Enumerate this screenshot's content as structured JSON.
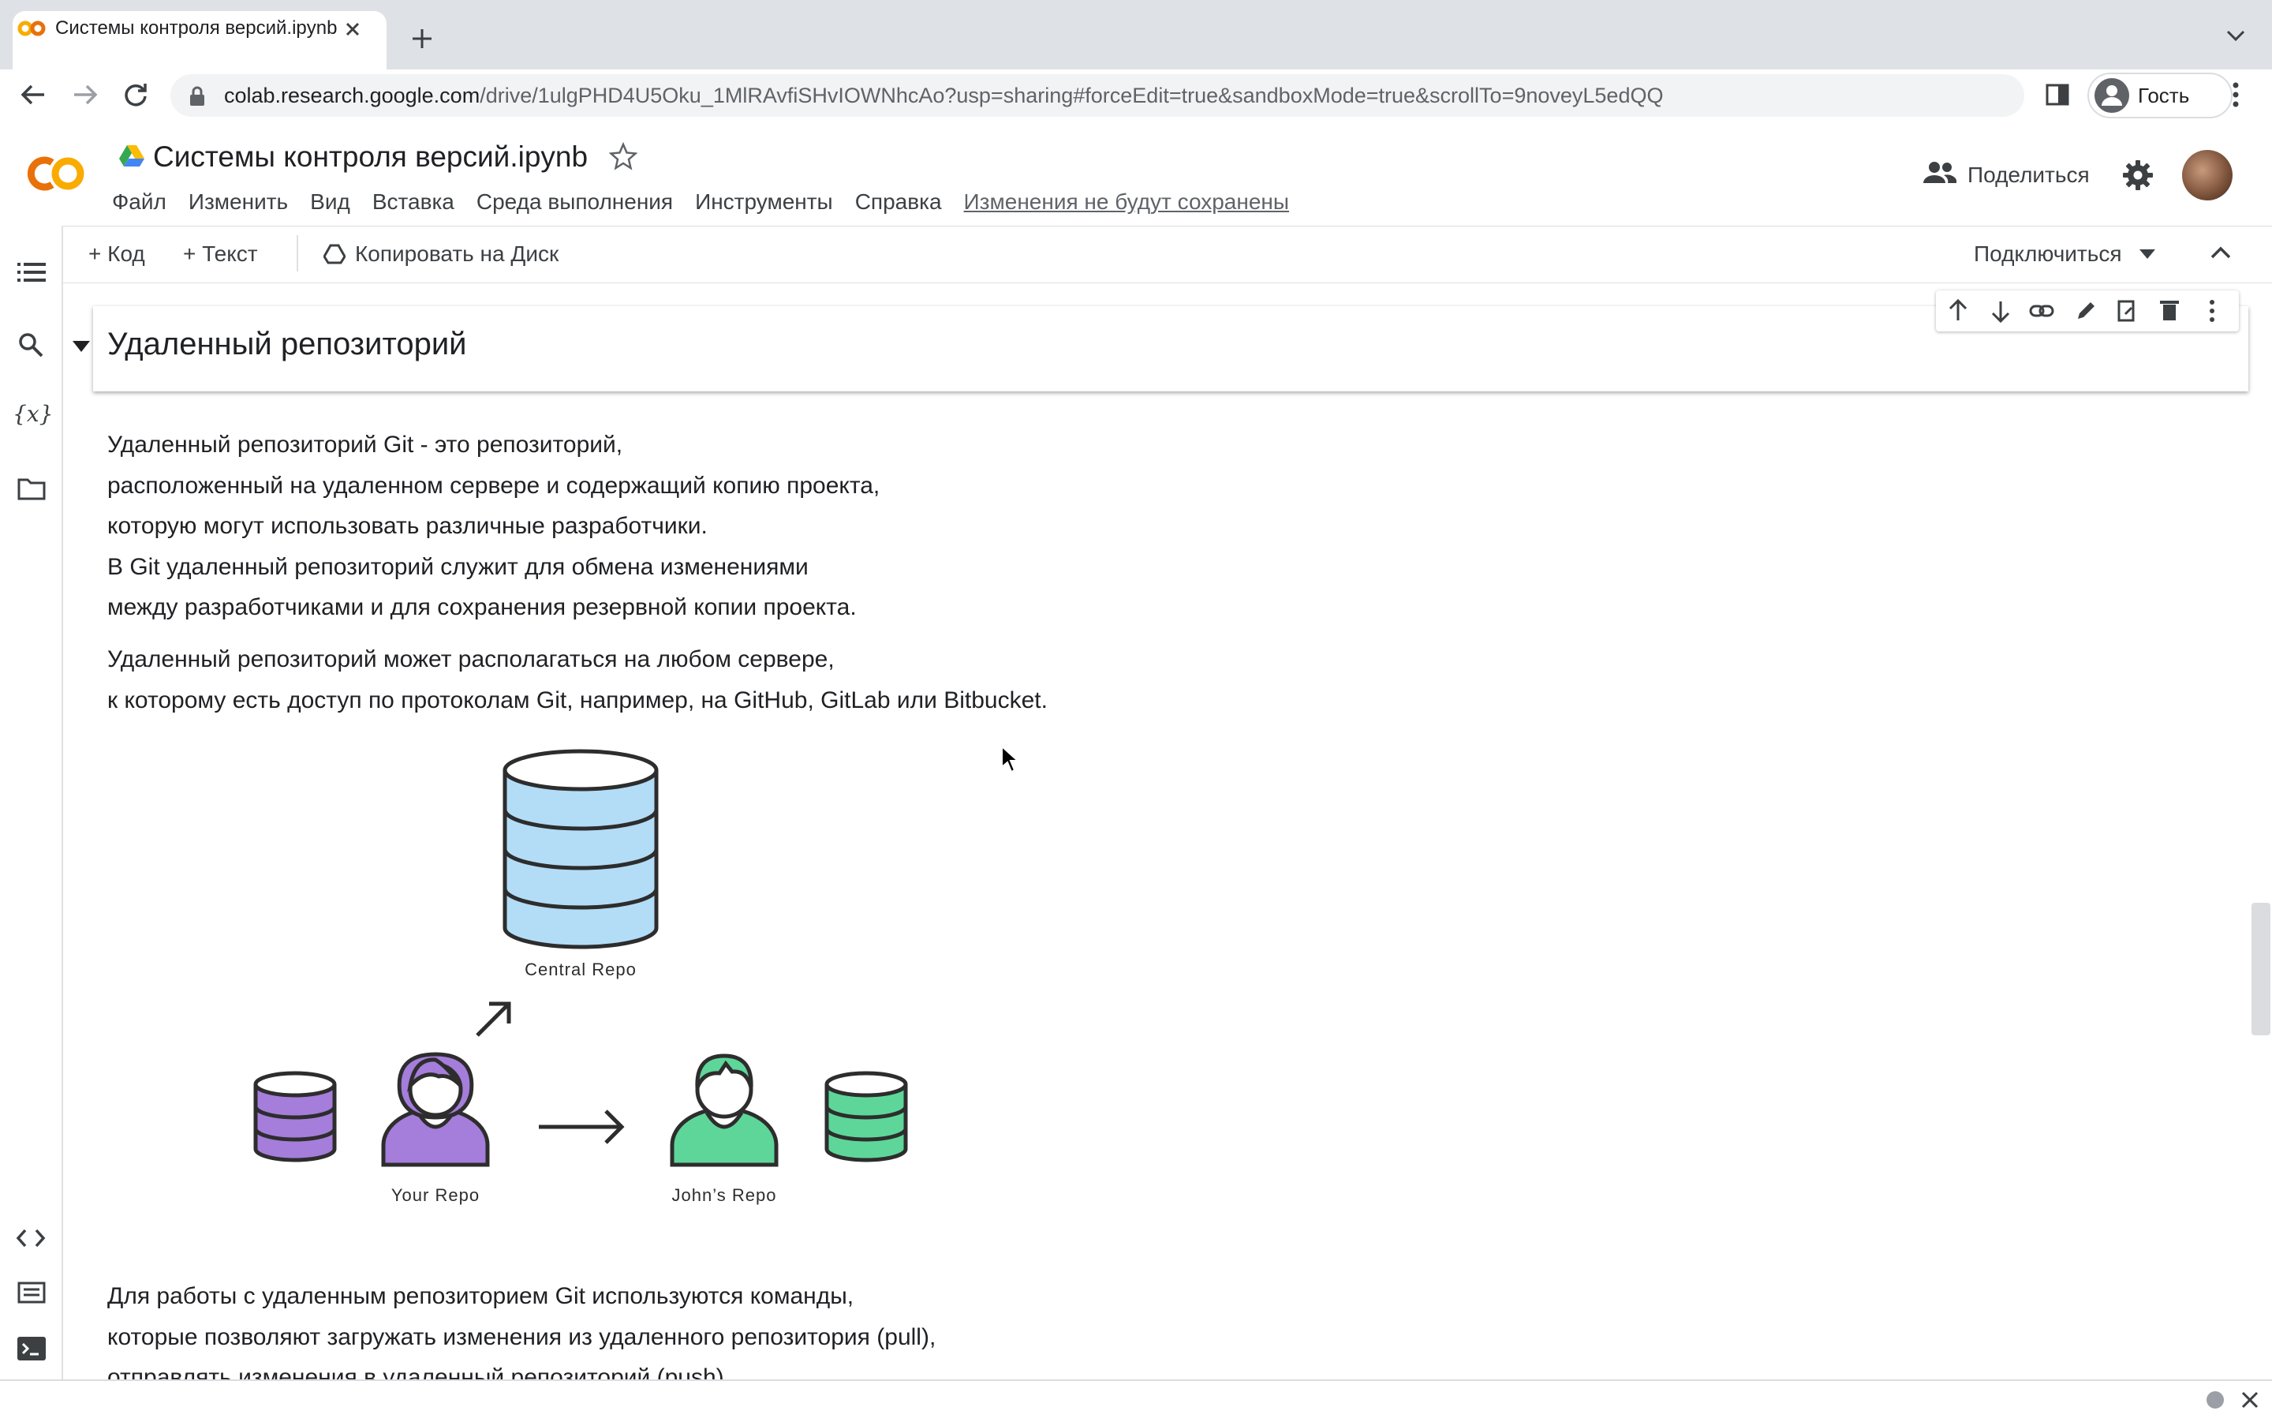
{
  "browser": {
    "tab_title": "Системы контроля версий.ipynb",
    "url_host": "colab.research.google.com",
    "url_path": "/drive/1ulgPHD4U5Oku_1MlRAvfiSHvIOWNhcAo?usp=sharing#forceEdit=true&sandboxMode=true&scrollTo=9noveyL5edQQ",
    "profile_label": "Гость"
  },
  "header": {
    "notebook_title": "Системы контроля версий.ipynb",
    "menu": [
      "Файл",
      "Изменить",
      "Вид",
      "Вставка",
      "Среда выполнения",
      "Инструменты",
      "Справка"
    ],
    "unsaved_notice": "Изменения не будут сохранены",
    "share_label": "Поделиться"
  },
  "toolbar": {
    "add_code": "Код",
    "add_text": "Текст",
    "copy_to_drive": "Копировать на Диск",
    "connect": "Подключиться"
  },
  "left_rail": {
    "icons": [
      "toc-icon",
      "search-icon",
      "variables-icon",
      "folder-icon",
      "code-snippets-icon",
      "command-palette-icon",
      "terminal-icon"
    ]
  },
  "cell_toolbar": {
    "icons": [
      "move-up-icon",
      "move-down-icon",
      "link-icon",
      "edit-icon",
      "mirror-cell-icon",
      "delete-icon",
      "more-icon"
    ]
  },
  "content": {
    "heading": "Удаленный репозиторий",
    "para1": [
      "Удаленный репозиторий Git - это репозиторий,",
      "расположенный на удаленном сервере и содержащий копию проекта,",
      "которую могут использовать различные разработчики.",
      "В Git удаленный репозиторий служит для обмена изменениями",
      "между разработчиками и для сохранения резервной копии проекта."
    ],
    "para2": [
      "Удаленный репозиторий может располагаться на любом сервере,",
      "к которому есть доступ по протоколам Git, например, на GitHub, GitLab или Bitbucket."
    ],
    "para3": [
      "Для работы с удаленным репозиторием Git используются команды,",
      "которые позволяют загружать изменения из удаленного репозитория (pull),",
      "отправлять изменения в удаленный репозиторий (push)."
    ],
    "diagram": {
      "central_label": "Central Repo",
      "your_label": "Your Repo",
      "john_label": "John’s Repo",
      "colors": {
        "central": "#b3dcf7",
        "your": "#a57ddb",
        "john": "#5ed69a",
        "stroke": "#2d2d2d"
      }
    }
  },
  "colors": {
    "colab_orange": "#f9ab00",
    "colab_dark_orange": "#e8710a",
    "tabstrip": "#dee1e6"
  }
}
